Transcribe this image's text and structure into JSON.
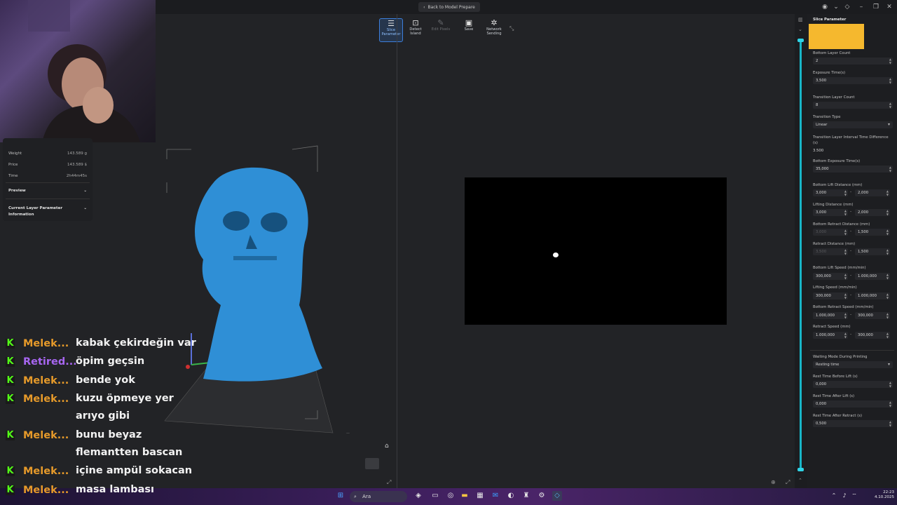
{
  "topbar": {
    "back_label": "Back to Model Prepare"
  },
  "toolbar": [
    {
      "label": "Slice\nParameter",
      "icon": "sliders-icon"
    },
    {
      "label": "Detect\nIsland",
      "icon": "target-icon"
    },
    {
      "label": "Edit Pixels",
      "icon": "pencil-icon"
    },
    {
      "label": "Save",
      "icon": "save-icon"
    },
    {
      "label": "Network\nSending",
      "icon": "network-icon"
    }
  ],
  "info": {
    "rows": [
      {
        "label": "Weight",
        "value": "143.589 g"
      },
      {
        "label": "Price",
        "value": "143.589 $"
      },
      {
        "label": "Time",
        "value": "2h44m45s"
      }
    ],
    "preview": "Preview",
    "current_layer": "Current Layer Parameter\nInformation"
  },
  "chat": [
    {
      "user": "Melek...",
      "msg": "kabak çekirdeğin var",
      "color": "#e69a2a"
    },
    {
      "user": "Retired...",
      "msg": "öpim geçsin",
      "color": "#a766f0"
    },
    {
      "user": "Melek...",
      "msg": "bende yok",
      "color": "#e69a2a"
    },
    {
      "user": "Melek...",
      "msg": "kuzu öpmeye yer arıyo gibi",
      "color": "#e69a2a"
    },
    {
      "user": "Melek...",
      "msg": "bunu beyaz flemantten bascan",
      "color": "#e69a2a"
    },
    {
      "user": "Melek...",
      "msg": "içine ampül sokacan",
      "color": "#e69a2a"
    },
    {
      "user": "Melek...",
      "msg": "masa lambası",
      "color": "#e69a2a"
    }
  ],
  "panel": {
    "title": "Slice Parameter",
    "bottom_layer_count_label": "Bottom Layer Count",
    "bottom_layer_count": "2",
    "exposure_time_label": "Exposure Time(s)",
    "exposure_time": "3,500",
    "transition_layer_count_label": "Transition Layer Count",
    "transition_layer_count": "8",
    "transition_type_label": "Transition Type",
    "transition_type": "Linear",
    "transition_interval_label": "Transition Layer Interval Time Difference\n(s)",
    "transition_interval": "3.500",
    "bottom_exposure_label": "Bottom Exposure Time(s)",
    "bottom_exposure": "35,000",
    "bottom_lift_distance_label": "Bottom Lift Distance (mm)",
    "bottom_lift_distance_a": "3,000",
    "bottom_lift_distance_b": "2,000",
    "lifting_distance_label": "Lifting Distance (mm)",
    "lifting_distance_a": "3,000",
    "lifting_distance_b": "2,000",
    "bottom_retract_distance_label": "Bottom Retract Distance (mm)",
    "bottom_retract_distance_a": "3,000",
    "bottom_retract_distance_b": "1,500",
    "retract_distance_label": "Retract Distance  (mm)",
    "retract_distance_a": "3,500",
    "retract_distance_b": "1,500",
    "bottom_lift_speed_label": "Bottom Lift Speed  (mm/min)",
    "bottom_lift_speed_a": "300,000",
    "bottom_lift_speed_b": "1.000,000",
    "lifting_speed_label": "Lifting Speed  (mm/min)",
    "lifting_speed_a": "300,000",
    "lifting_speed_b": "1.000,000",
    "bottom_retract_speed_label": "Bottom Retract Speed  (mm/min)",
    "bottom_retract_speed_a": "1.000,000",
    "bottom_retract_speed_b": "300,000",
    "retract_speed_label": "Retract Speed  (mm)",
    "retract_speed_a": "1.000,000",
    "retract_speed_b": "300,000",
    "waiting_mode_label": "Waiting Mode During Printing",
    "waiting_mode": "Resting time",
    "rest_before_lift_label": "Rest Time Before Lift  (s)",
    "rest_before_lift": "0,000",
    "rest_after_lift_label": "Rest Time After Lift  (s)",
    "rest_after_lift": "0,000",
    "rest_after_retract_label": "Rest Time After Retract  (s)",
    "rest_after_retract": "0,500"
  },
  "taskbar": {
    "search_placeholder": "Ara",
    "time": "22:23",
    "date": "4.10.2025"
  },
  "colors": {
    "accent": "#3c7fdc",
    "slider": "#18b5c8",
    "model": "#2f8fd6",
    "thumbnail": "#f5b82e"
  }
}
